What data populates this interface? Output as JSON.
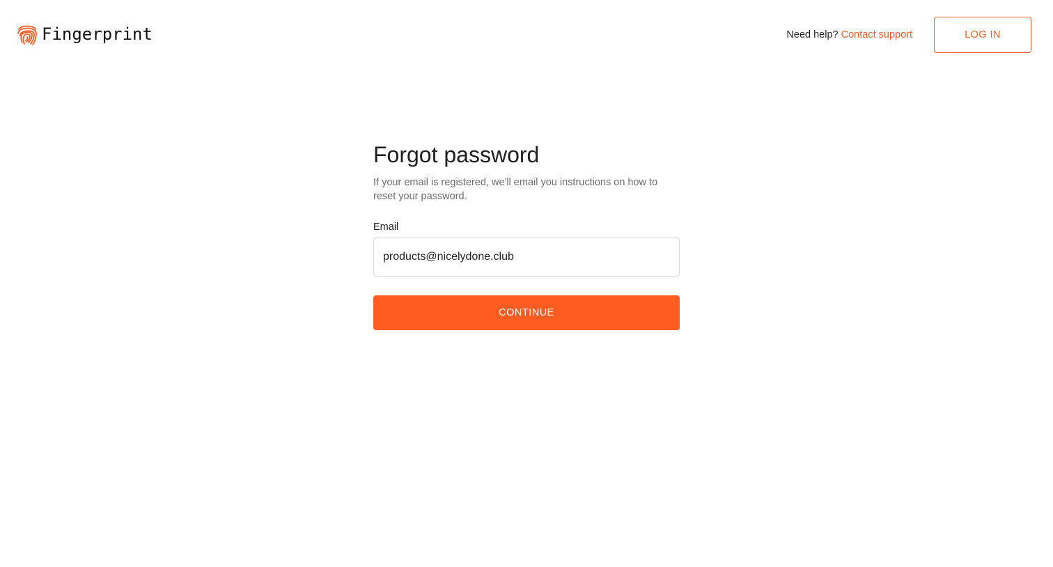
{
  "header": {
    "brand_name": "Fingerprint",
    "logo_icon": "fingerprint-icon",
    "help_text": "Need help?",
    "support_link": "Contact support",
    "login_label": "LOG IN"
  },
  "form": {
    "title": "Forgot password",
    "description": "If your email is registered, we'll email you instructions on how to reset your password.",
    "email_label": "Email",
    "email_value": "products@nicelydone.club",
    "continue_label": "CONTINUE"
  },
  "colors": {
    "accent": "#f35b22",
    "button_bg": "#ff5c22",
    "text": "#1f1f1f",
    "muted_text": "#6b6b6b",
    "input_border": "#d8d8d8"
  }
}
